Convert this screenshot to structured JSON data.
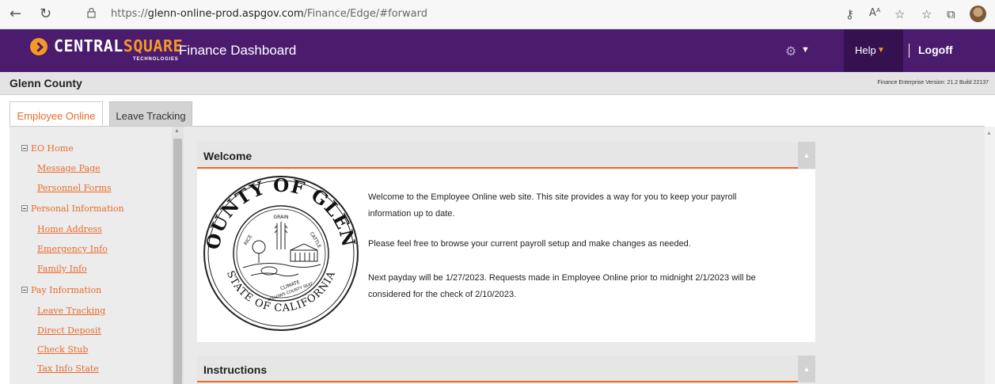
{
  "browser": {
    "url_prefix": "https://",
    "url_host": "glenn-online-prod.aspgov.com",
    "url_path": "/Finance/Edge/#forward"
  },
  "header": {
    "logo_central": "CENTRAL",
    "logo_square": "SQUARE",
    "logo_tech": "TECHNOLOGIES",
    "app_title": "Finance Dashboard",
    "help_label": "Help",
    "logoff_label": "Logoff",
    "bg_color": "#4b1b6e",
    "accent_color": "#f39a22"
  },
  "county": {
    "name": "Glenn County",
    "version": "Finance Enterprise Version: 21.2 Build 22137"
  },
  "tabs": [
    {
      "label": "Employee Online",
      "active": true
    },
    {
      "label": "Leave Tracking",
      "active": false
    }
  ],
  "sidebar": {
    "sections": [
      {
        "label": "EO Home",
        "items": [
          "Message Page",
          "Personnel Forms"
        ]
      },
      {
        "label": "Personal Information",
        "items": [
          "Home Address",
          "Emergency Info",
          "Family Info"
        ]
      },
      {
        "label": "Pay Information",
        "items": [
          "Leave Tracking",
          "Direct Deposit",
          "Check Stub",
          "Tax Info State"
        ]
      }
    ]
  },
  "welcome": {
    "title": "Welcome",
    "seal": {
      "top_text": "COUNTY OF GLENN",
      "bottom_text": "STATE OF CALIFORNIA",
      "inner_top": "GRAIN",
      "inner_left": "RICE",
      "inner_right": "CATTLE",
      "inner_bottom": "CLIMATE",
      "inner_band": "WILLOWS COUNTY SEAT"
    },
    "para1_line1": "Welcome to the Employee Online web site. This site provides a way for you to keep your payroll",
    "para1_line2": "information up to date.",
    "para2": "Please feel free to browse your current payroll setup and make changes as needed.",
    "para3_line1": "Next payday will be 1/27/2023. Requests made in Employee Online prior to midnight 2/1/2023 will be",
    "para3_line2": "considered for the check of 2/10/2023."
  },
  "instructions": {
    "title": "Instructions"
  },
  "colors": {
    "link_orange": "#e86b2a"
  }
}
